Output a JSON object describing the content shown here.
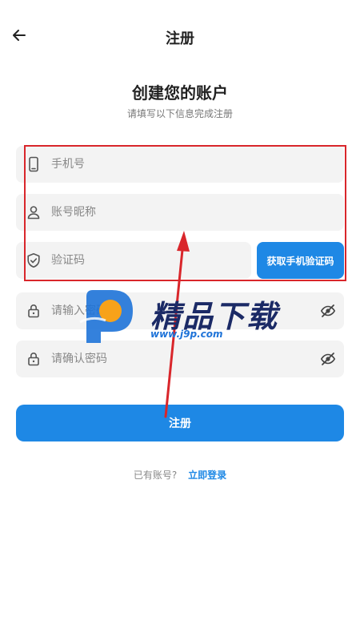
{
  "header": {
    "title": "注册",
    "back_icon": "arrow-left-icon"
  },
  "intro": {
    "heading": "创建您的账户",
    "subheading": "请填写以下信息完成注册"
  },
  "form": {
    "phone": {
      "placeholder": "手机号",
      "value": "",
      "icon": "phone-icon"
    },
    "nickname": {
      "placeholder": "账号昵称",
      "value": "",
      "icon": "user-icon"
    },
    "code": {
      "placeholder": "验证码",
      "value": "",
      "icon": "shield-icon",
      "button_label": "获取手机验证码"
    },
    "password": {
      "placeholder": "请输入密码",
      "value": "",
      "icon": "lock-icon",
      "toggle_icon": "eye-off-icon"
    },
    "confirm_password": {
      "placeholder": "请确认密码",
      "value": "",
      "icon": "lock-icon",
      "toggle_icon": "eye-off-icon"
    }
  },
  "actions": {
    "register_label": "注册"
  },
  "footer": {
    "prompt": "已有账号?",
    "login_link": "立即登录"
  },
  "watermark": {
    "title": "精品下载",
    "url": "www.j9p.com"
  },
  "colors": {
    "accent": "#1e88e5",
    "annotation": "#d9262b",
    "field_bg": "#f3f3f3"
  }
}
